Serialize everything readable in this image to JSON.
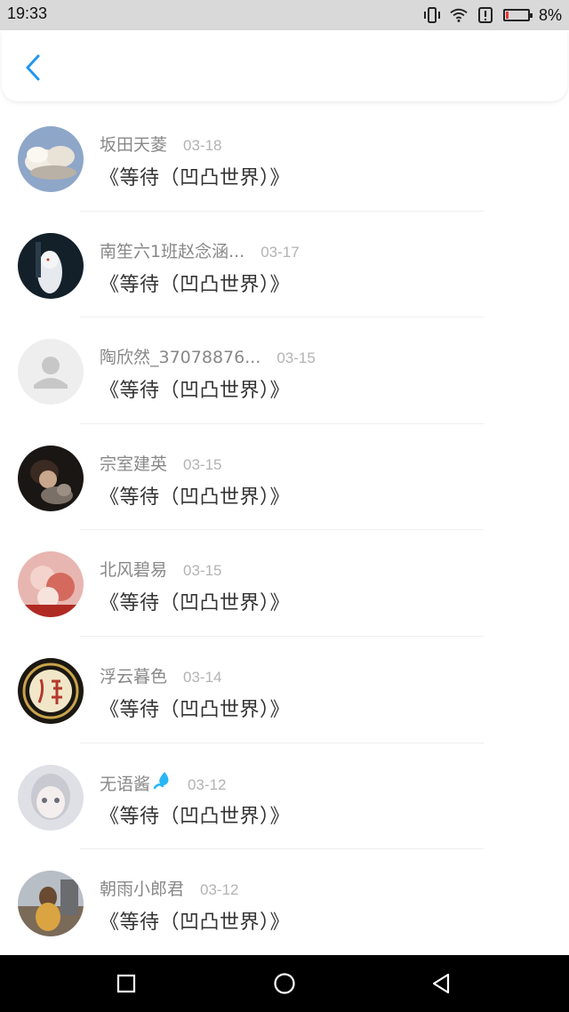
{
  "status_bar": {
    "time": "19:33",
    "battery_percent": "8%",
    "battery_level": 0.08,
    "icons": [
      "vibrate-icon",
      "wifi-icon",
      "alert-icon",
      "battery-icon"
    ]
  },
  "header": {
    "back_icon": "chevron-left-icon",
    "accent_color": "#2196f3"
  },
  "items": [
    {
      "name": "坂田天菱",
      "date": "03-18",
      "title": "《等待（凹凸世界）》"
    },
    {
      "name": "南笙六1班赵念涵...",
      "date": "03-17",
      "title": "《等待（凹凸世界）》"
    },
    {
      "name": "陶欣然_37078876...",
      "date": "03-15",
      "title": "《等待（凹凸世界）》"
    },
    {
      "name": "宗室建英",
      "date": "03-15",
      "title": "《等待（凹凸世界）》"
    },
    {
      "name": "北风碧易",
      "date": "03-15",
      "title": "《等待（凹凸世界）》"
    },
    {
      "name": "浮云暮色",
      "date": "03-14",
      "title": "《等待（凹凸世界）》"
    },
    {
      "name": "无语酱",
      "date": "03-12",
      "title": "《等待（凹凸世界）》"
    },
    {
      "name": "朝雨小郎君",
      "date": "03-12",
      "title": "《等待（凹凸世界）》"
    }
  ],
  "nav_bar": {
    "icons": [
      "recent-apps-icon",
      "home-icon",
      "back-icon"
    ]
  }
}
